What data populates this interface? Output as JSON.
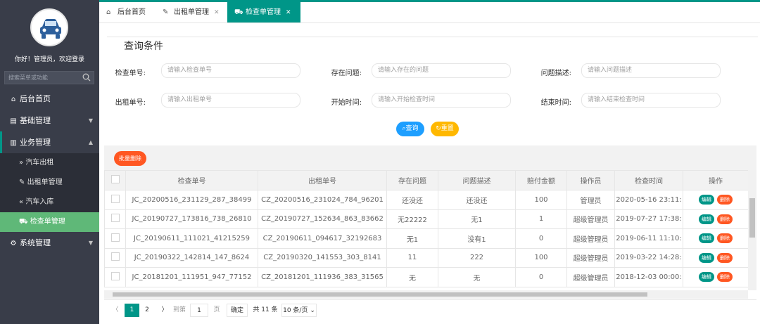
{
  "sidebar": {
    "welcome": "你好！管理员，欢迎登录",
    "search_placeholder": "搜索菜单或功能",
    "items": [
      {
        "label": "后台首页",
        "icon": "home-icon"
      },
      {
        "label": "基础管理",
        "icon": "form-icon"
      },
      {
        "label": "业务管理",
        "icon": "book-icon"
      },
      {
        "label": "系统管理",
        "icon": "gear-icon"
      }
    ],
    "sub_items": [
      {
        "label": "汽车出租",
        "icon": "double-right-icon"
      },
      {
        "label": "出租单管理",
        "icon": "edit-doc-icon"
      },
      {
        "label": "汽车入库",
        "icon": "double-left-icon"
      },
      {
        "label": "检查单管理",
        "icon": "car-icon"
      }
    ]
  },
  "tabs": [
    {
      "label": "后台首页",
      "icon": "home-icon"
    },
    {
      "label": "出租单管理",
      "icon": "edit-doc-icon"
    },
    {
      "label": "检查单管理",
      "icon": "car-icon"
    }
  ],
  "query": {
    "legend": "查询条件",
    "fields": [
      {
        "label": "检查单号:",
        "placeholder": "请输入检查单号"
      },
      {
        "label": "存在问题:",
        "placeholder": "请输入存在的问题"
      },
      {
        "label": "问题描述:",
        "placeholder": "请输入问题描述"
      },
      {
        "label": "出租单号:",
        "placeholder": "请输入出租单号"
      },
      {
        "label": "开始时间:",
        "placeholder": "请输入开始检查时间"
      },
      {
        "label": "结束时间:",
        "placeholder": "请输入结束检查时间"
      }
    ],
    "search_label": "查询",
    "reset_label": "重置"
  },
  "table": {
    "batch_delete_label": "批量删除",
    "columns": [
      "检查单号",
      "出租单号",
      "存在问题",
      "问题描述",
      "赔付金额",
      "操作员",
      "检查时间",
      "操作"
    ],
    "rows": [
      [
        "JC_20200516_231129_287_38499",
        "CZ_20200516_231024_784_96201",
        "还没还",
        "还没还",
        "100",
        "管理员",
        "2020-05-16 23:11:"
      ],
      [
        "JC_20190727_173816_738_26810",
        "CZ_20190727_152634_863_83662",
        "无22222",
        "无1",
        "1",
        "超级管理员",
        "2019-07-27 17:38:"
      ],
      [
        "JC_20190611_111021_41215259",
        "CZ_20190611_094617_32192683",
        "无1",
        "没有1",
        "0",
        "超级管理员",
        "2019-06-11 11:10:"
      ],
      [
        "JC_20190322_142814_147_8624",
        "CZ_20190320_141553_303_8141",
        "11",
        "222",
        "100",
        "超级管理员",
        "2019-03-22 14:28:"
      ],
      [
        "JC_20181201_111951_947_77152",
        "CZ_20181201_111936_383_31565",
        "无",
        "无",
        "0",
        "超级管理员",
        "2018-12-03 00:00:"
      ]
    ],
    "edit_label": "编辑",
    "delete_label": "删除"
  },
  "pager": {
    "pages": [
      "1",
      "2"
    ],
    "goto_label": "到第",
    "goto_value": "1",
    "page_unit": "页",
    "confirm_label": "确定",
    "total": "共 11 条",
    "per_page": "10 条/页"
  },
  "colors": {
    "accent": "#009688",
    "sidebar": "#393d49",
    "active_menu": "#5fb878",
    "danger": "#ff5722",
    "search_btn": "#1e9fff",
    "reset_btn": "#ffb800"
  }
}
